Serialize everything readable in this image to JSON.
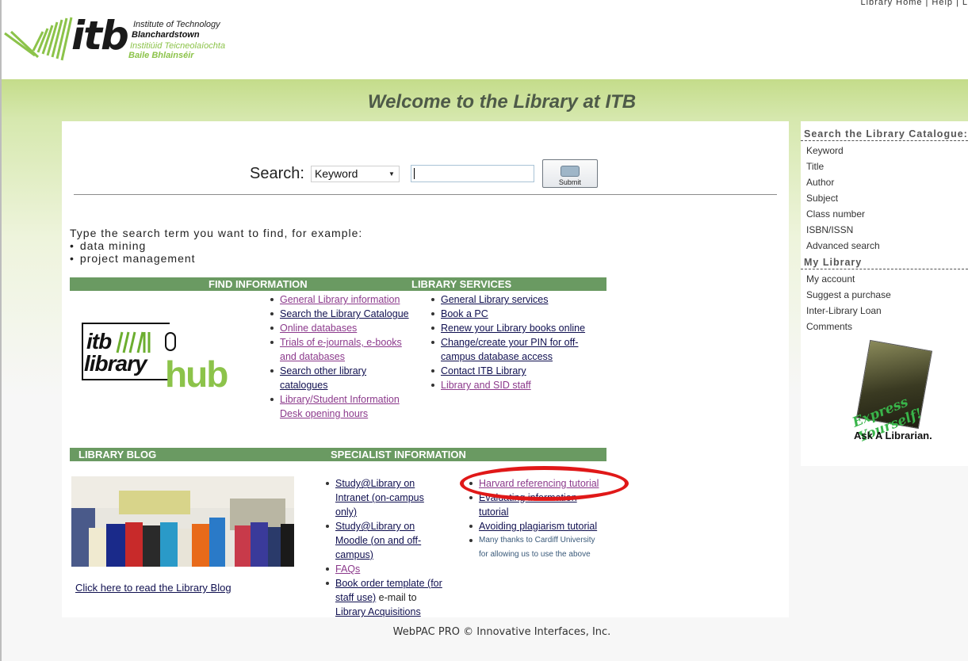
{
  "top_links": [
    "Library Home",
    "Help",
    "L"
  ],
  "logo": {
    "mark": "itb",
    "line1": "Institute of Technology",
    "line2": "Blanchardstown",
    "line3": "Institiúid Teicneolaíochta",
    "line4": "Baile Bhlainséir"
  },
  "welcome": "Welcome to the Library at ITB",
  "search": {
    "label": "Search:",
    "type_selected": "Keyword",
    "query_value": "",
    "submit_label": "Submit"
  },
  "hint": {
    "text": "Type the search term you want to find, for example:",
    "examples": [
      "data mining",
      "project management"
    ]
  },
  "sections": {
    "find_information": "FIND INFORMATION",
    "library_services": "LIBRARY SERVICES",
    "library_blog": "LIBRARY BLOG",
    "specialist_information": "SPECIALIST INFORMATION"
  },
  "hub_logo": {
    "line1": "itb",
    "line2": "library",
    "line3": "hub"
  },
  "find_links": [
    {
      "label": "General Library information",
      "visited": true
    },
    {
      "label": "Search the Library Catalogue",
      "visited": false
    },
    {
      "label": "Online databases",
      "visited": true
    },
    {
      "label": "Trials of e-journals, e-books and databases",
      "visited": true
    },
    {
      "label": "Search other library catalogues",
      "visited": false
    },
    {
      "label": "Library/Student Information Desk opening hours",
      "visited": true
    }
  ],
  "service_links": [
    {
      "label": "General Library services",
      "visited": false
    },
    {
      "label": "Book a PC",
      "visited": false
    },
    {
      "label": "Renew your Library books online",
      "visited": false
    },
    {
      "label": "Change/create your PIN for off-campus database access",
      "visited": false
    },
    {
      "label": "Contact ITB Library",
      "visited": false
    },
    {
      "label": "Library and SID staff",
      "visited": true
    }
  ],
  "blog_link": "Click here to read the Library Blog",
  "specialist_left": {
    "study_intranet": "Study@Library on Intranet (on-campus only)",
    "study_moodle": "Study@Library on Moodle (on and off-campus)",
    "faqs": "FAQs",
    "book_order": "Book order template (for staff use)",
    "book_order_suffix": " e-mail to ",
    "acquisitions": "Library Acquisitions"
  },
  "specialist_right": {
    "harvard": "Harvard referencing tutorial",
    "evaluating": "Evaluating information tutorial",
    "plagiarism": "Avoiding plagiarism tutorial",
    "note_line1": "Many thanks to Cardiff University",
    "note_line2": "for allowing us to use the above"
  },
  "sidebar": {
    "catalogue_heading": "Search the Library Catalogue:",
    "catalogue_items": [
      "Keyword",
      "Title",
      "Author",
      "Subject",
      "Class number",
      "ISBN/ISSN",
      "Advanced search"
    ],
    "my_library_heading": "My Library",
    "my_library_items": [
      "My account",
      "Suggest a purchase",
      "Inter-Library Loan",
      "Comments"
    ],
    "ask_banner": {
      "tagline": "Express Yourself!",
      "label": "Ask A Librarian."
    }
  },
  "footer": "WebPAC PRO © Innovative Interfaces, Inc.",
  "colors": {
    "section_bar": "#6a9a62",
    "accent_green": "#8cc34a",
    "link": "#101050",
    "visited_link": "#8c3a8c",
    "annotation": "#e01818"
  }
}
